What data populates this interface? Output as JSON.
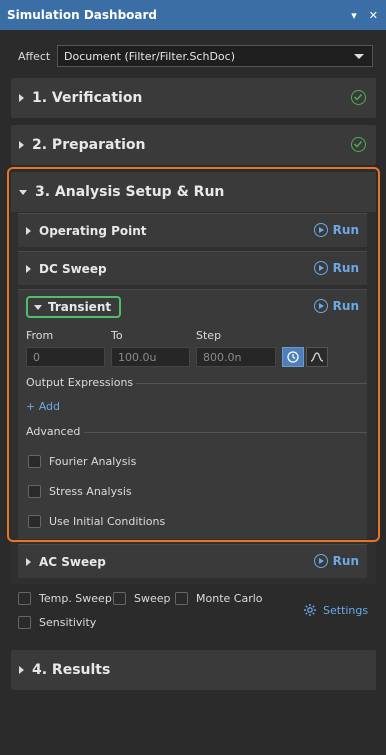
{
  "window": {
    "title": "Simulation Dashboard",
    "pin_icon": "pin-icon",
    "close_icon": "close-icon",
    "pin_glyph": "▾",
    "close_glyph": "✕"
  },
  "affect": {
    "label": "Affect",
    "value": "Document (Filter/Filter.SchDoc)"
  },
  "sections": {
    "verification": {
      "label": "1. Verification",
      "status": "ok"
    },
    "preparation": {
      "label": "2. Preparation",
      "status": "ok"
    },
    "analysis": {
      "label": "3. Analysis Setup & Run"
    },
    "results": {
      "label": "4. Results"
    }
  },
  "analyses": {
    "operating_point": {
      "label": "Operating Point",
      "run": "Run"
    },
    "dc_sweep": {
      "label": "DC Sweep",
      "run": "Run"
    },
    "transient": {
      "label": "Transient",
      "run": "Run",
      "from_label": "From",
      "to_label": "To",
      "step_label": "Step",
      "from_value": "0",
      "to_value": "100.0u",
      "step_value": "800.0n",
      "output_expressions_label": "Output Expressions",
      "add_label": "+ Add",
      "advanced_label": "Advanced",
      "fourier_label": "Fourier Analysis",
      "stress_label": "Stress Analysis",
      "initial_conditions_label": "Use Initial Conditions"
    },
    "ac_sweep": {
      "label": "AC Sweep",
      "run": "Run"
    }
  },
  "options": {
    "temp_sweep": "Temp. Sweep",
    "sweep": "Sweep",
    "monte_carlo": "Monte Carlo",
    "sensitivity": "Sensitivity",
    "settings": "Settings"
  },
  "colors": {
    "accent": "#6aa9e4",
    "highlight_orange": "#e8742a",
    "highlight_green": "#4fbd6a",
    "ok_green": "#4caf50",
    "titlebar": "#3a6ea5"
  }
}
